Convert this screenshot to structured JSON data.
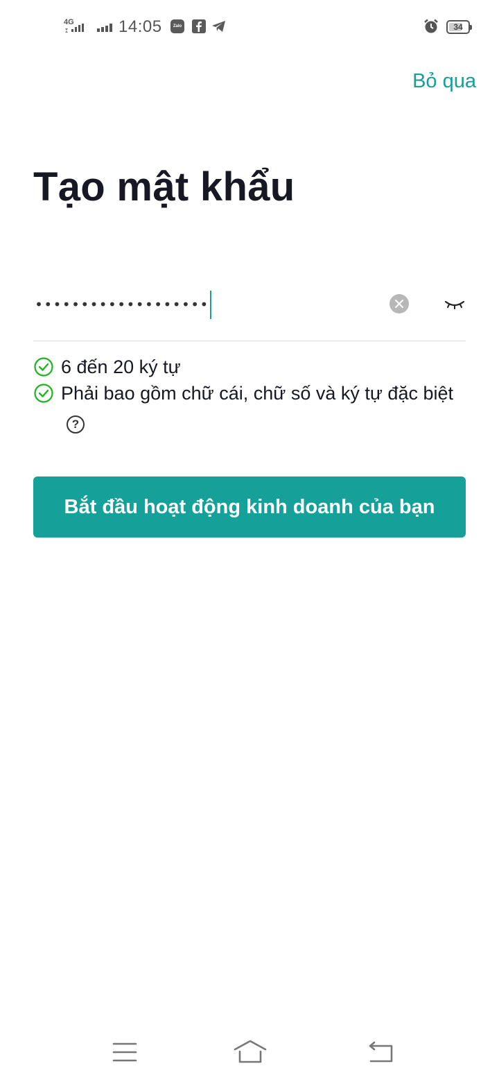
{
  "status_bar": {
    "network": "4G",
    "time": "14:05",
    "zalo_label": "Zalo",
    "battery_level": "34",
    "icons": [
      "signal-icon",
      "zalo-icon",
      "facebook-icon",
      "telegram-icon",
      "alarm-icon",
      "battery-icon"
    ]
  },
  "header": {
    "skip_label": "Bỏ qua"
  },
  "page": {
    "title": "Tạo mật khẩu"
  },
  "password": {
    "masked_value": "•••••••••••••••••••",
    "clear_icon": "clear-icon",
    "visibility_icon": "eye-closed-icon"
  },
  "rules": [
    {
      "text": "6 đến 20 ký tự",
      "status": "satisfied"
    },
    {
      "text": "Phải bao gồm chữ cái, chữ số và ký tự đặc biệt",
      "status": "satisfied"
    }
  ],
  "help_symbol": "?",
  "primary_action": {
    "label": "Bắt đầu hoạt động kinh doanh của bạn"
  },
  "colors": {
    "accent": "#15a09a",
    "check": "#1fb31f",
    "text": "#161823"
  },
  "nav_bar": {
    "icons": [
      "menu-icon",
      "home-icon",
      "back-icon"
    ]
  }
}
